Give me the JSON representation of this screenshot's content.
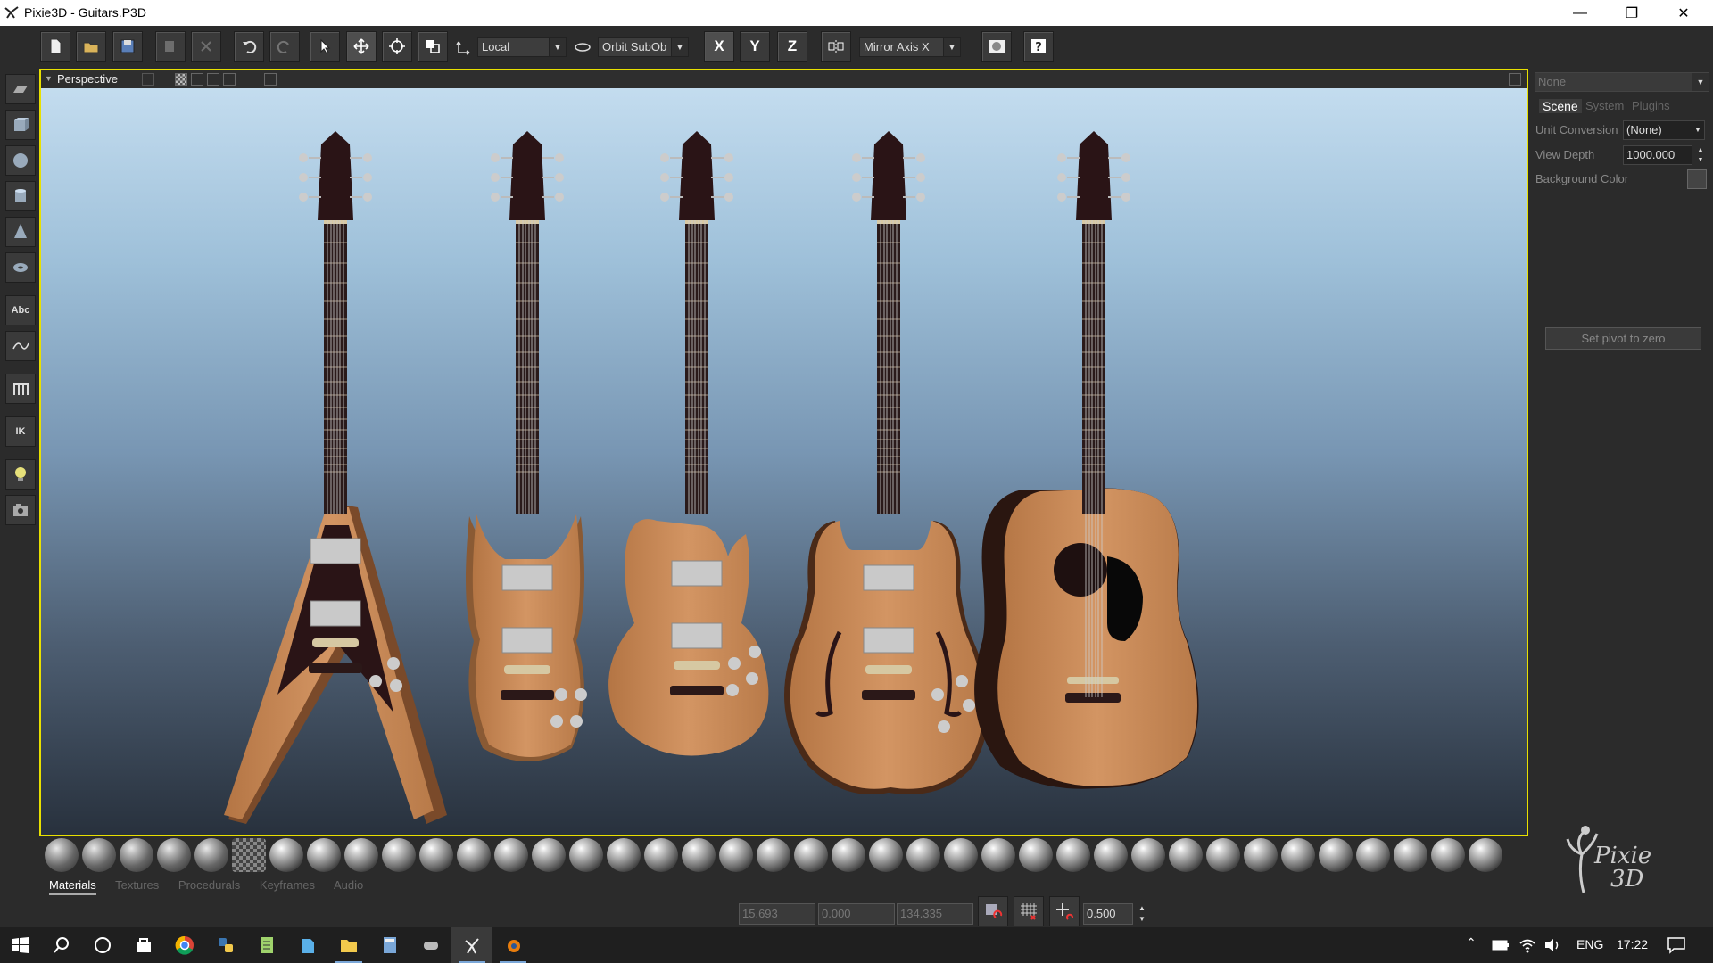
{
  "window": {
    "title": "Pixie3D - Guitars.P3D"
  },
  "toolbar": {
    "coord_space": "Local",
    "orbit_mode": "Orbit SubOb",
    "axis_x": "X",
    "axis_y": "Y",
    "axis_z": "Z",
    "mirror_axis": "Mirror Axis X"
  },
  "sidebar": {
    "text_tool": "Abc",
    "ik_tool": "IK"
  },
  "viewport": {
    "title": "Perspective"
  },
  "right_panel": {
    "object_select": "None",
    "tabs": [
      {
        "label": "Scene"
      },
      {
        "label": "System"
      },
      {
        "label": "Plugins"
      }
    ],
    "unit_conversion_label": "Unit Conversion",
    "unit_conversion_value": "(None)",
    "view_depth_label": "View Depth",
    "view_depth_value": "1000.000",
    "background_color_label": "Background Color",
    "set_pivot_button": "Set pivot to zero"
  },
  "bottom_tabs": [
    {
      "label": "Materials"
    },
    {
      "label": "Textures"
    },
    {
      "label": "Procedurals"
    },
    {
      "label": "Keyframes"
    },
    {
      "label": "Audio"
    }
  ],
  "coords": {
    "x": "15.693",
    "y": "0.000",
    "z": "134.335",
    "snap": "0.500"
  },
  "logo": {
    "line1": "Pixie",
    "line2": "3D"
  },
  "taskbar": {
    "language": "ENG",
    "time": "17:22"
  },
  "colors": {
    "viewport_border": "#e8e000",
    "guitar_body": "#c68652"
  }
}
